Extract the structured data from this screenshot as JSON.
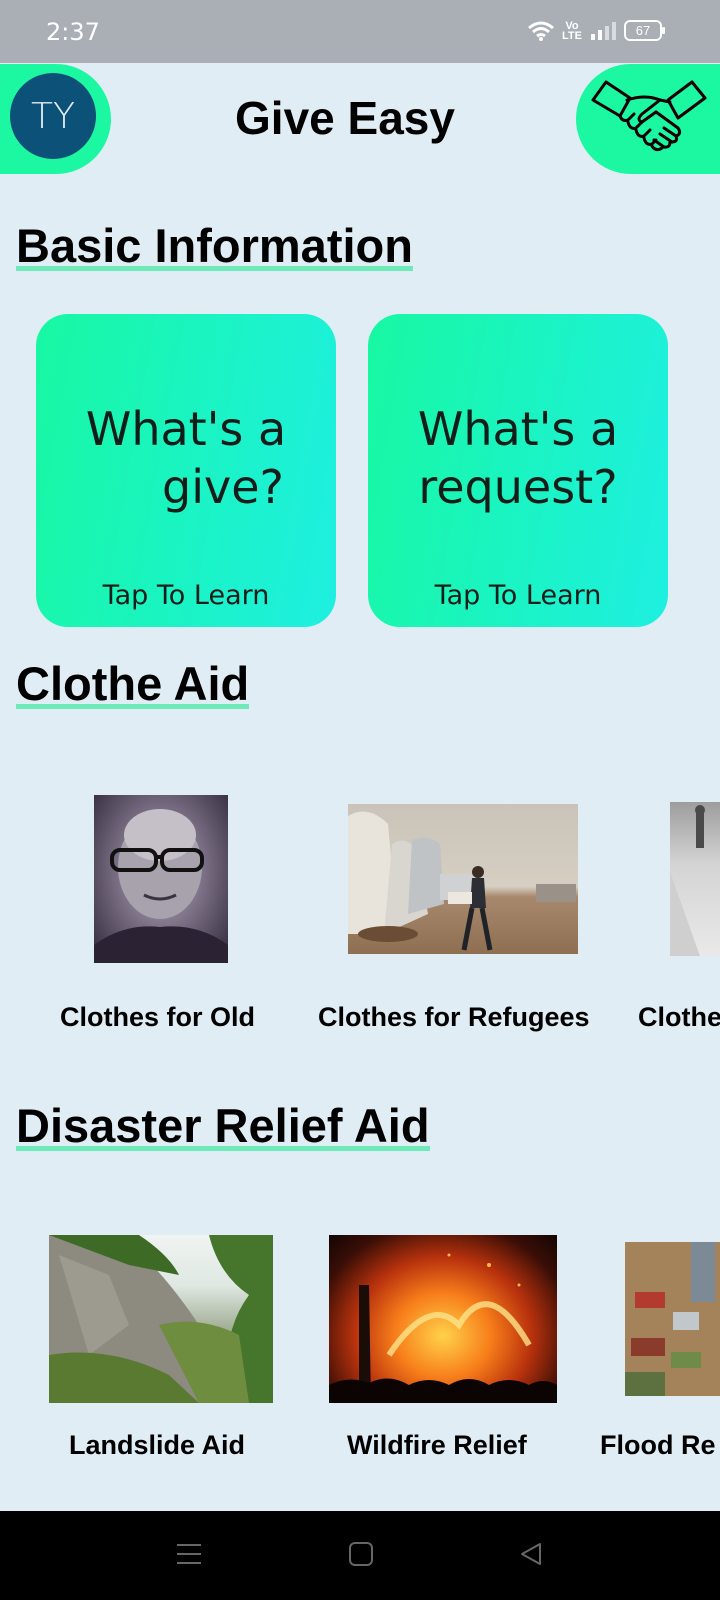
{
  "status": {
    "time": "2:37",
    "volte_top": "Vo",
    "volte_bottom": "LTE",
    "battery": "67"
  },
  "header": {
    "avatar_initials": "TY",
    "title": "Give Easy"
  },
  "sections": {
    "basic": {
      "title": "Basic Information",
      "cards": [
        {
          "line1": "What's a",
          "line2": "give?",
          "tap": "Tap To Learn"
        },
        {
          "line1": "What's a",
          "line2": "request?",
          "tap": "Tap To Learn"
        }
      ]
    },
    "clothe": {
      "title": "Clothe Aid",
      "items": [
        "Clothes for Old",
        "Clothes for Refugees",
        "Clothe"
      ]
    },
    "disaster": {
      "title": "Disaster Relief Aid",
      "items": [
        "Landslide Aid",
        "Wildfire Relief",
        "Flood Re"
      ]
    }
  },
  "colors": {
    "accent": "#1cf7a1",
    "avatar": "#0c5178",
    "background": "#e1edf4",
    "underline": "#6eeab9"
  },
  "icons": {
    "header_right": "handshake-icon",
    "nav": [
      "menu-icon",
      "home-icon",
      "back-icon"
    ]
  }
}
